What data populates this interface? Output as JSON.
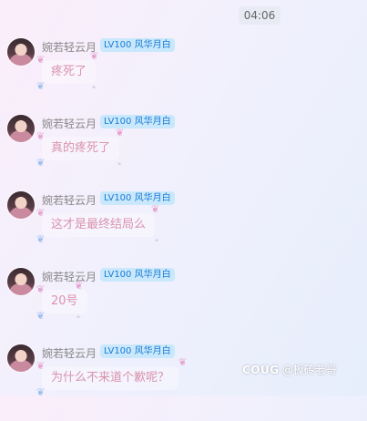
{
  "timestamp": "04:06",
  "messages": [
    {
      "name": "婉若轻云月",
      "badge": "LV100 风华月白",
      "text": "疼死了"
    },
    {
      "name": "婉若轻云月",
      "badge": "LV100 风华月白",
      "text": "真的疼死了"
    },
    {
      "name": "婉若轻云月",
      "badge": "LV100 风华月白",
      "text": "这才是最终结局么"
    },
    {
      "name": "婉若轻云月",
      "badge": "LV100 风华月白",
      "text": "20号"
    },
    {
      "name": "婉若轻云月",
      "badge": "LV100 风华月白",
      "text": "为什么不来道个歉呢？"
    }
  ],
  "watermark": {
    "logo": "COUG",
    "text": "@板砖老哥"
  }
}
